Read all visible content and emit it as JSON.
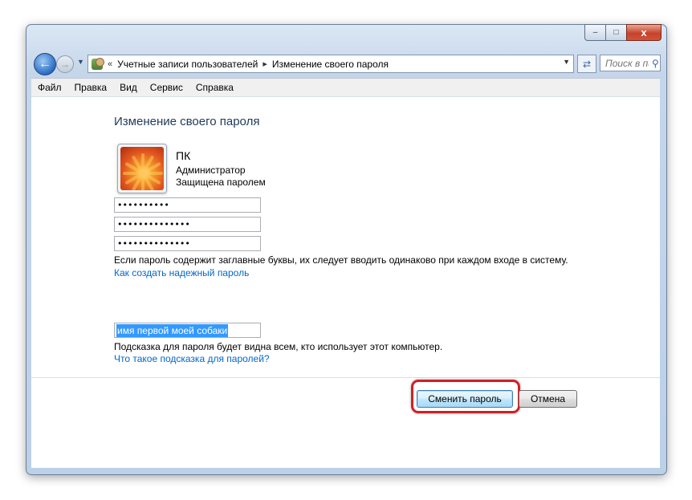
{
  "window": {
    "caption_buttons": {
      "minimize": "–",
      "maximize": "□",
      "close": "x"
    }
  },
  "nav": {
    "back_icon": "back-arrow-icon",
    "forward_icon": "forward-arrow-icon",
    "breadcrumb_lead": "«",
    "breadcrumb": [
      "Учетные записи пользователей",
      "Изменение своего пароля"
    ],
    "breadcrumb_separator": "▸",
    "search_placeholder": "Поиск в пан..."
  },
  "menu": [
    "Файл",
    "Правка",
    "Вид",
    "Сервис",
    "Справка"
  ],
  "page": {
    "title": "Изменение своего пароля",
    "user": {
      "name": "ПК",
      "role": "Администратор",
      "status": "Защищена паролем"
    },
    "password_fields": {
      "current": "••••••••••",
      "new": "••••••••••••••",
      "confirm": "••••••••••••••"
    },
    "caps_note": "Если пароль содержит заглавные буквы, их следует вводить одинаково при каждом входе в систему.",
    "strong_password_link": "Как создать надежный пароль",
    "hint_value": "имя первой моей собаки",
    "hint_note": "Подсказка для пароля будет видна всем, кто использует этот компьютер.",
    "hint_link": "Что такое подсказка для паролей?",
    "buttons": {
      "change": "Сменить пароль",
      "cancel": "Отмена"
    }
  },
  "colors": {
    "link": "#0066cc",
    "title": "#1e395b",
    "highlight": "#d21f24",
    "selection": "#3399ff"
  }
}
